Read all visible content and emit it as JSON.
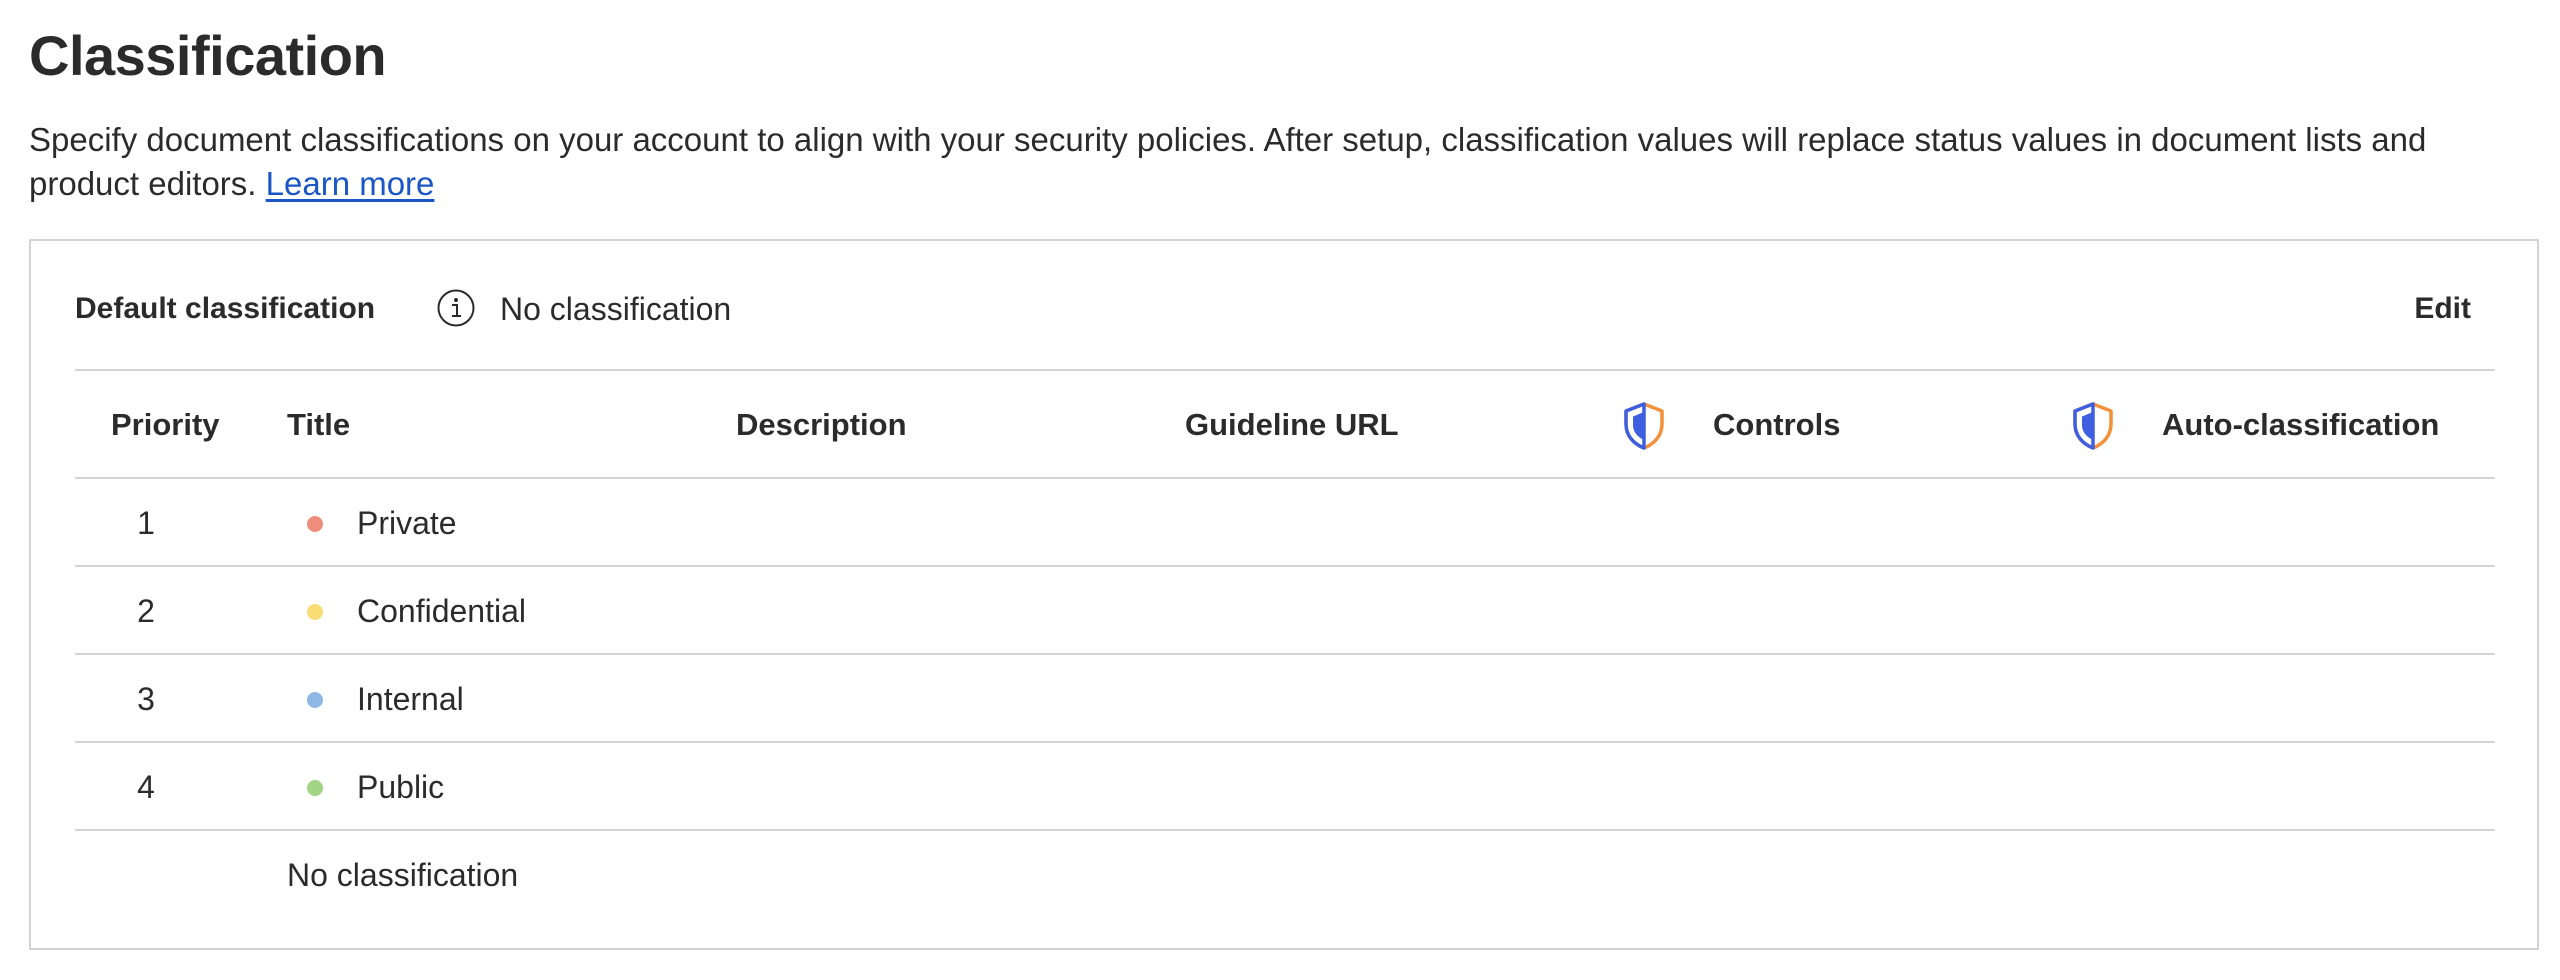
{
  "page": {
    "title": "Classification",
    "description": "Specify document classifications on your account to align with your security policies. After setup, classification values will replace status values in document lists and product editors.",
    "learn_more": "Learn more"
  },
  "default_classification": {
    "label": "Default classification",
    "value": "No classification",
    "edit_label": "Edit"
  },
  "table": {
    "columns": {
      "priority": "Priority",
      "title": "Title",
      "description": "Description",
      "guideline_url": "Guideline URL",
      "controls": "Controls",
      "auto_classification": "Auto-classification"
    },
    "rows": [
      {
        "priority": "1",
        "title": "Private",
        "color": "#ee8d7c"
      },
      {
        "priority": "2",
        "title": "Confidential",
        "color": "#f8dc74"
      },
      {
        "priority": "3",
        "title": "Internal",
        "color": "#8fb7e5"
      },
      {
        "priority": "4",
        "title": "Public",
        "color": "#9fd583"
      }
    ],
    "footer_row": {
      "title": "No classification"
    }
  },
  "icons": {
    "info": "info-circle-icon",
    "shield": "shield-icon"
  },
  "colors": {
    "link": "#1a56c6",
    "shield_blue": "#3d5fe0",
    "shield_orange": "#f2913a",
    "border": "#d4d4d4",
    "text": "#2b2b2b"
  }
}
